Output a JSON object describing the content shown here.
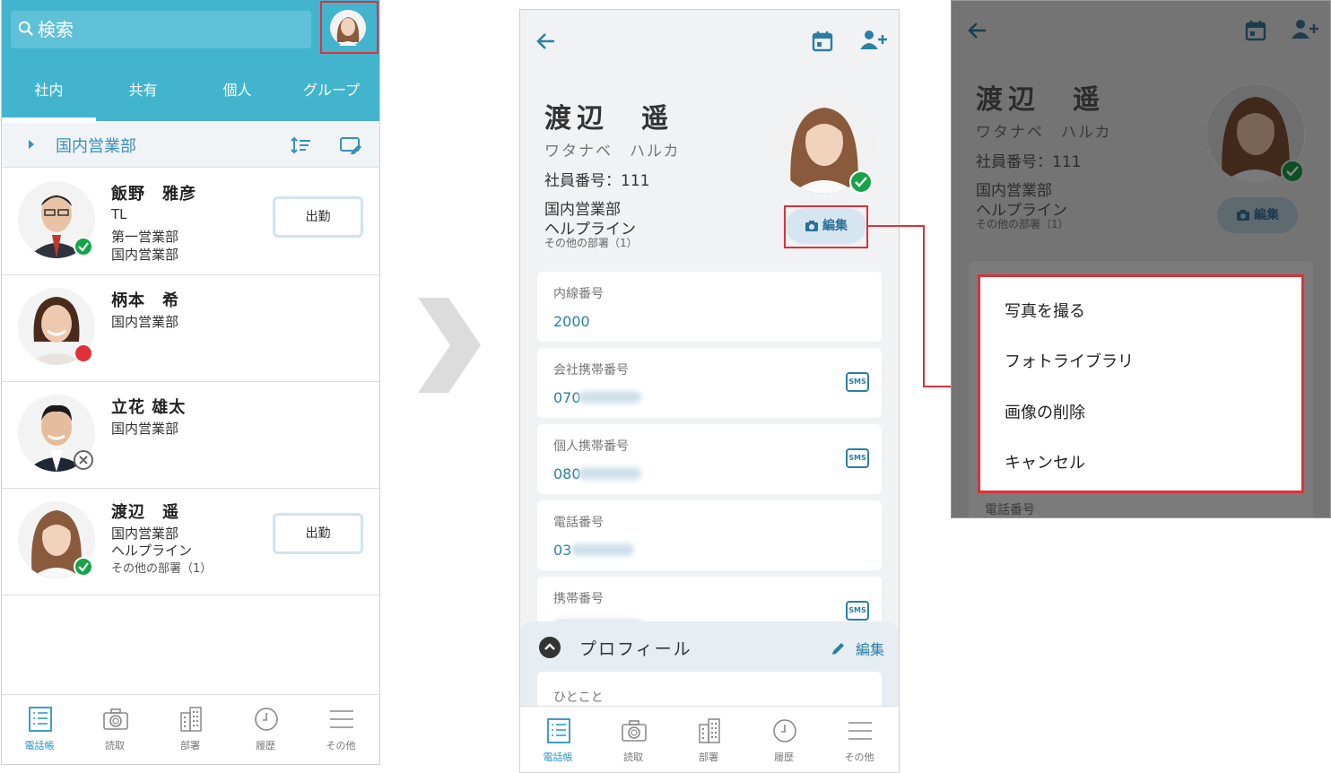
{
  "colors": {
    "accent": "#43b4ce",
    "highlight": "#e0303a",
    "link": "#2a7fa3",
    "online": "#17a34a"
  },
  "screen1": {
    "search_placeholder": "検索",
    "tabs": [
      {
        "label": "社内",
        "active": true
      },
      {
        "label": "共有",
        "active": false
      },
      {
        "label": "個人",
        "active": false
      },
      {
        "label": "グループ",
        "active": false
      }
    ],
    "dept_header": "国内営業部",
    "people": [
      {
        "name": "飯野　雅彦",
        "lines": [
          "TL",
          "第一営業部",
          "国内営業部"
        ],
        "status": "online",
        "button": "出勤"
      },
      {
        "name": "柄本　希",
        "lines": [
          "国内営業部"
        ],
        "status": "busy",
        "button": ""
      },
      {
        "name": "立花 雄太",
        "lines": [
          "国内営業部"
        ],
        "status": "offline",
        "button": ""
      },
      {
        "name": "渡辺　遥",
        "lines": [
          "国内営業部",
          "ヘルプライン"
        ],
        "note": "その他の部署（1）",
        "status": "online",
        "button": "出勤"
      }
    ]
  },
  "nav": {
    "items": [
      {
        "label": "電話帳",
        "icon": "phonebook-icon",
        "active": true
      },
      {
        "label": "読取",
        "icon": "camera-icon",
        "active": false
      },
      {
        "label": "部署",
        "icon": "building-icon",
        "active": false
      },
      {
        "label": "履歴",
        "icon": "clock-icon",
        "active": false
      },
      {
        "label": "その他",
        "icon": "menu-icon",
        "active": false
      }
    ]
  },
  "profile": {
    "name": "渡辺　遥",
    "kana": "ワタナベ　ハルカ",
    "employee_no": "社員番号：111",
    "dept1": "国内営業部",
    "dept2": "ヘルプライン",
    "other_depts": "その他の部署（1）",
    "edit_photo": "編集"
  },
  "screen2": {
    "fields": [
      {
        "label": "内線番号",
        "value": "2000",
        "sms": false
      },
      {
        "label": "会社携帯番号",
        "value": "070",
        "sms": true
      },
      {
        "label": "個人携帯番号",
        "value": "080",
        "sms": true
      },
      {
        "label": "電話番号",
        "value": "03",
        "sms": false
      },
      {
        "label": "携帯番号",
        "value": "",
        "sms": true
      }
    ],
    "sms_label": "SMS",
    "profile_section": "プロフィール",
    "profile_edit": "編集",
    "hitokoto": "ひとこと"
  },
  "screen3": {
    "menu": [
      "写真を撮る",
      "フォトライブラリ",
      "画像の削除",
      "キャンセル"
    ],
    "peek_label": "電話番号"
  }
}
